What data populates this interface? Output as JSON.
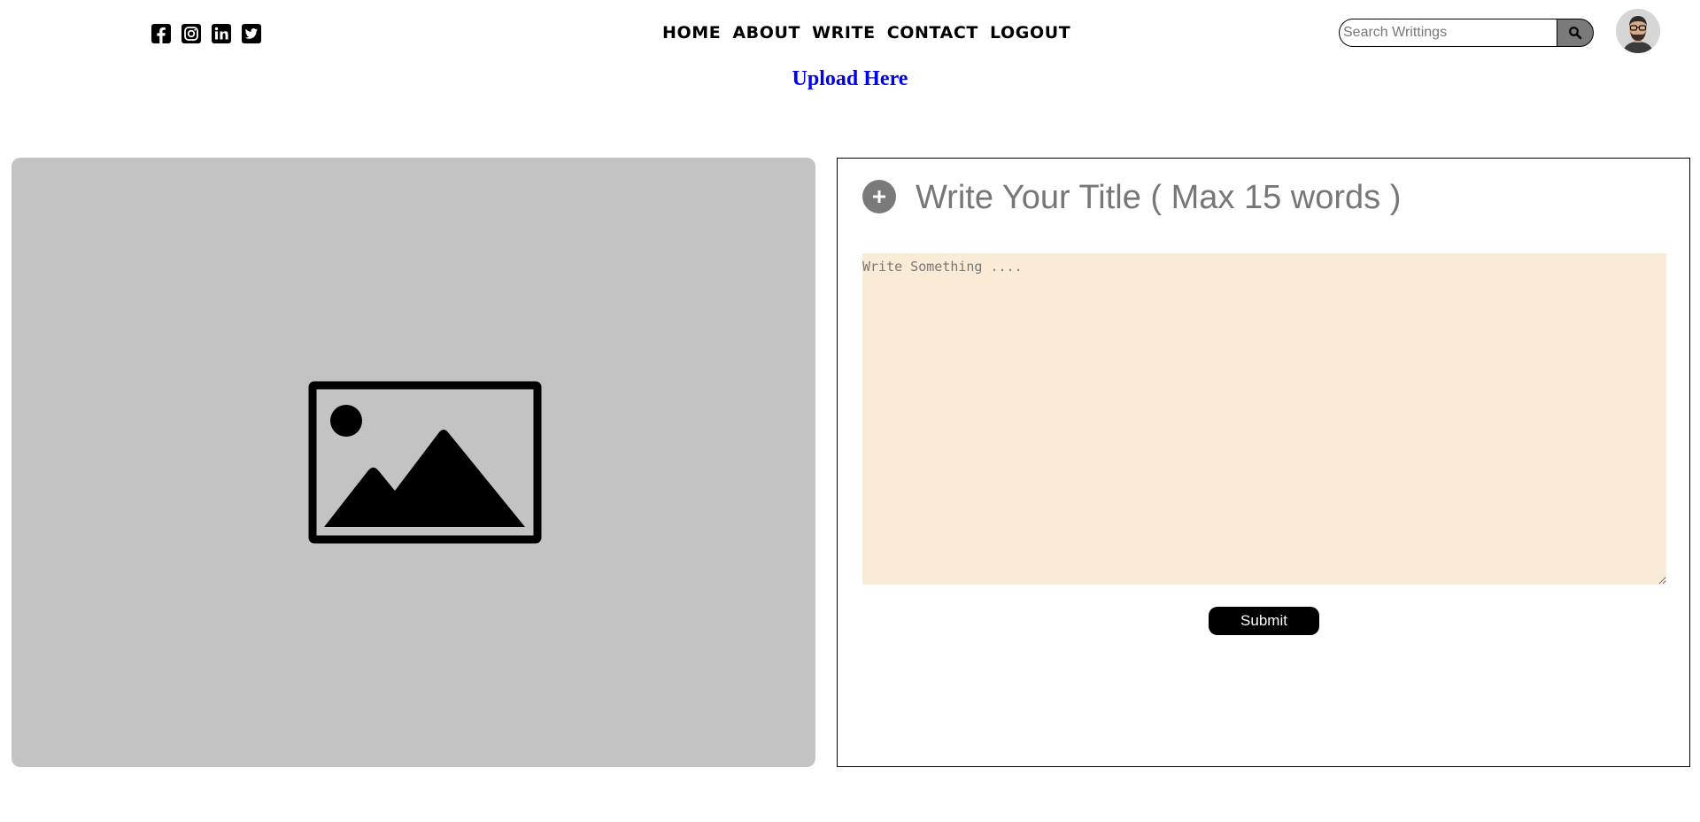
{
  "header": {
    "social": [
      {
        "name": "facebook-icon"
      },
      {
        "name": "instagram-icon"
      },
      {
        "name": "linkedin-icon"
      },
      {
        "name": "twitter-icon"
      }
    ],
    "nav": [
      "HOME",
      "ABOUT",
      "WRITE",
      "CONTACT",
      "LOGOUT"
    ],
    "search": {
      "placeholder": "Search Writtings",
      "button_icon": "search-icon"
    },
    "avatar": {
      "icon": "user-avatar"
    }
  },
  "upload": {
    "label": "Upload Here"
  },
  "image_panel": {
    "icon": "image-placeholder-icon"
  },
  "write_panel": {
    "add_icon": "plus-icon",
    "title_placeholder": "Write Your Title ( Max 15 words )",
    "body_placeholder": "Write Something ....",
    "submit_label": "Submit"
  },
  "colors": {
    "image_panel_bg": "#c3c3c3",
    "textarea_bg": "#faebd7",
    "link": "#0000ee",
    "button_bg": "#000000",
    "icon_grey": "#7a7a7a"
  }
}
